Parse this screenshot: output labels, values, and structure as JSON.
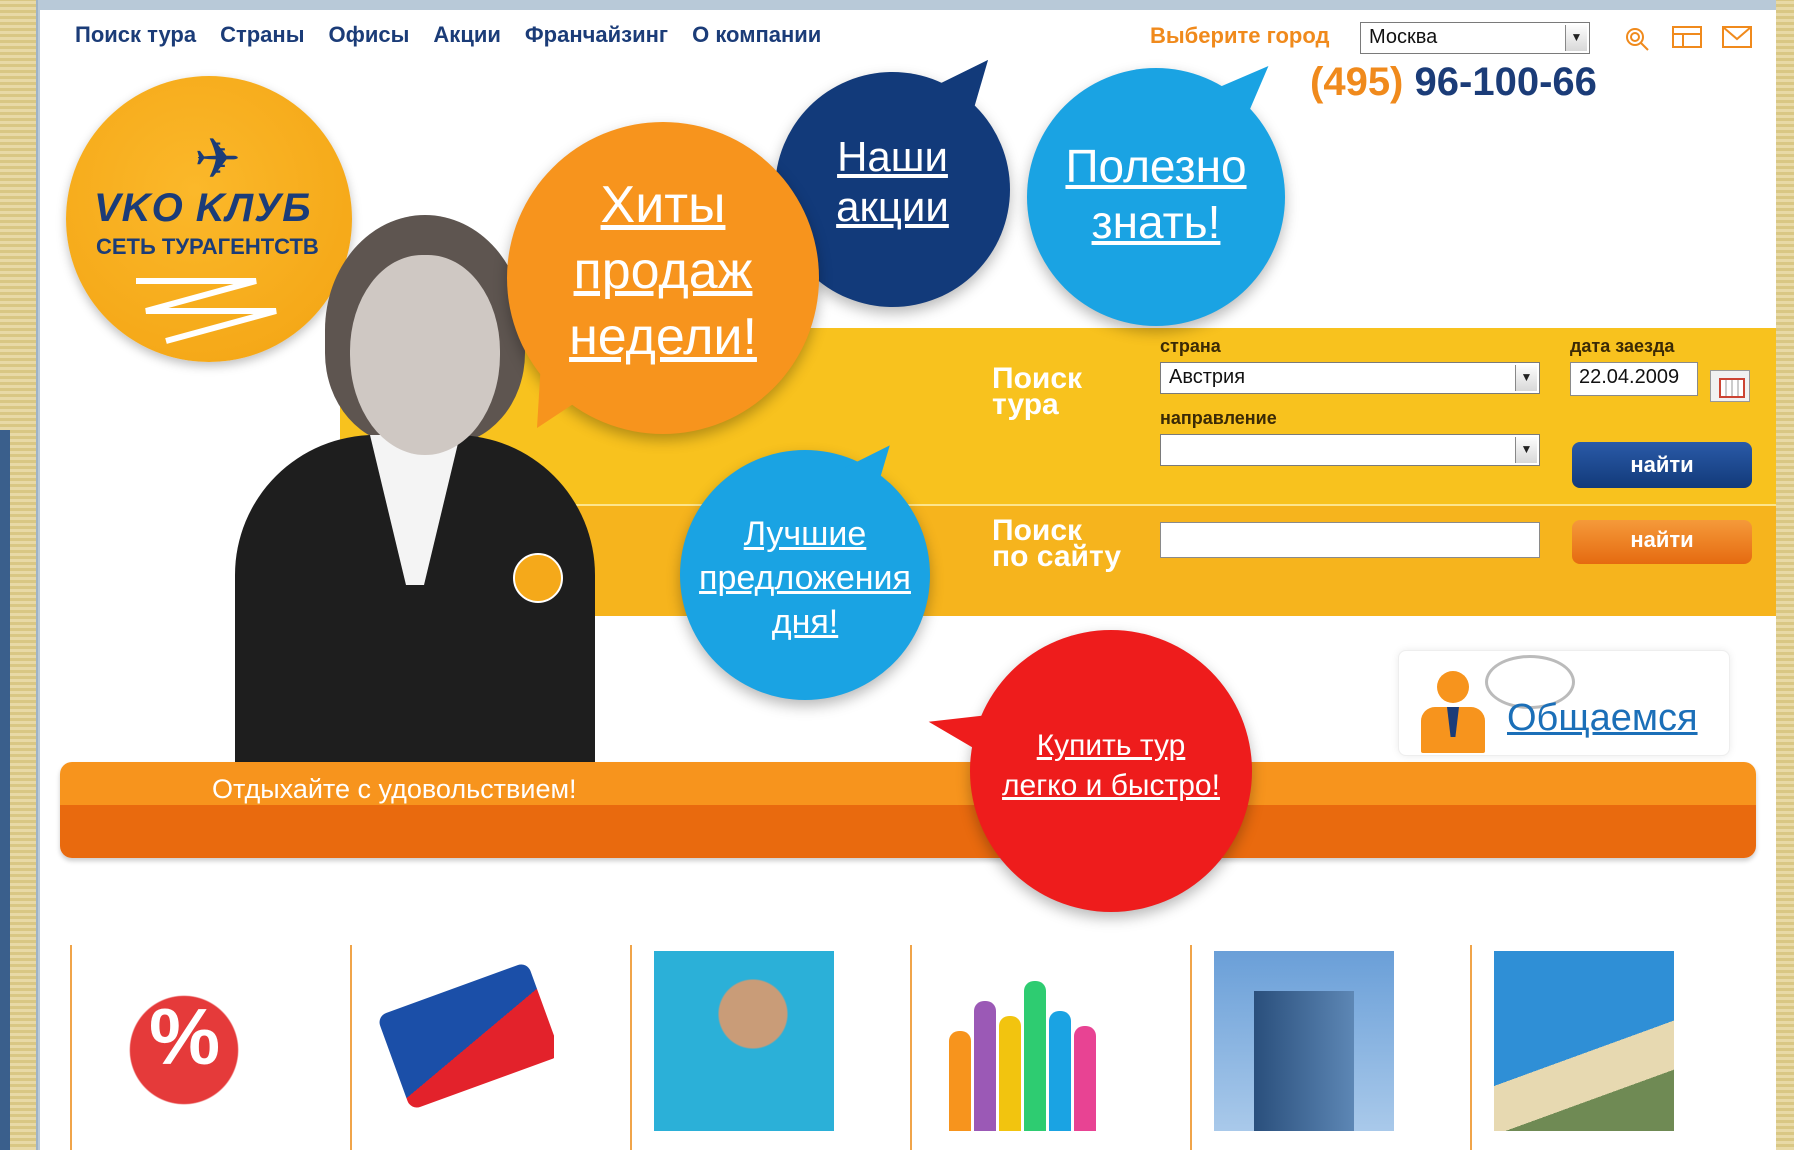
{
  "nav": {
    "items": [
      "Поиск тура",
      "Страны",
      "Офисы",
      "Акции",
      "Франчайзинг",
      "О компании"
    ]
  },
  "city": {
    "label": "Выберите город",
    "selected": "Москва"
  },
  "phone": {
    "code": "(495)",
    "number": "96-100-66"
  },
  "logo": {
    "name": "VKO KЛУБ",
    "tagline": "СЕТЬ ТУРАГЕНТСТВ"
  },
  "bubbles": {
    "hits": [
      "Хиты",
      "продаж",
      "недели!"
    ],
    "promo": [
      "Наши",
      "акции"
    ],
    "useful": [
      "Полезно",
      "знать!"
    ],
    "best": [
      "Лучшие",
      "предложения",
      "дня!"
    ],
    "buy": [
      "Купить тур",
      "легко и быстро!"
    ]
  },
  "tour_search": {
    "title_line1": "Поиск",
    "title_line2": "тура",
    "country_label": "страна",
    "country_value": "Австрия",
    "direction_label": "направление",
    "direction_value": "",
    "date_label": "дата заезда",
    "date_value": "22.04.2009",
    "find_label": "найти"
  },
  "site_search": {
    "title_line1": "Поиск",
    "title_line2": "по сайту",
    "query": "",
    "find_label": "найти"
  },
  "chat": {
    "label": "Общаемся"
  },
  "banner": {
    "slogan": "Отдыхайте с удовольствием!"
  },
  "colors": {
    "navy": "#1b3c78",
    "orange": "#f7941d",
    "yellow": "#f8c21e",
    "sky": "#1aa3e3",
    "red": "#ee1c1c"
  },
  "icons": [
    "search-icon",
    "sitemap-icon",
    "mail-icon",
    "calendar-icon",
    "chat-person-icon"
  ]
}
